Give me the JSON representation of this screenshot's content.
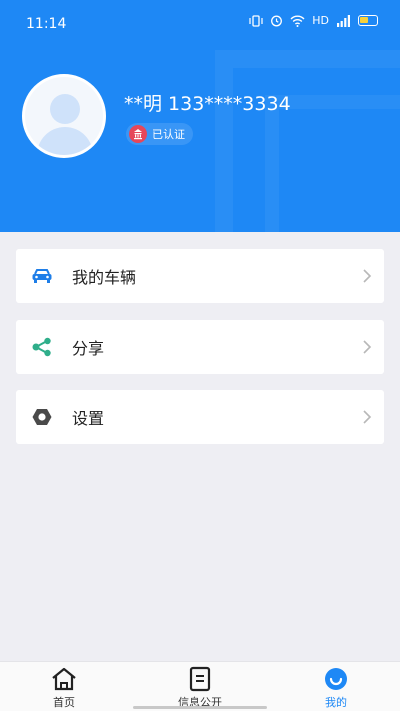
{
  "status_bar": {
    "time": "11:14",
    "network_label": "HD",
    "icons": [
      "vibrate-icon",
      "alarm-icon",
      "wifi-icon",
      "signal-icon",
      "battery-icon"
    ]
  },
  "profile": {
    "username": "**明  133****3334",
    "verified_label": "已认证"
  },
  "menu": {
    "items": [
      {
        "label": "我的车辆",
        "icon": "car-icon",
        "color": "#1e7ee8"
      },
      {
        "label": "分享",
        "icon": "share-icon",
        "color": "#2fae8a"
      },
      {
        "label": "设置",
        "icon": "settings-icon",
        "color": "#555555"
      }
    ]
  },
  "tabbar": {
    "tabs": [
      {
        "label": "首页",
        "icon": "home-icon"
      },
      {
        "label": "信息公开",
        "icon": "document-icon"
      },
      {
        "label": "我的",
        "icon": "profile-icon",
        "active": true
      }
    ]
  },
  "colors": {
    "header": "#1e88f5",
    "background": "#eeeef3",
    "accent": "#1e88f5"
  }
}
